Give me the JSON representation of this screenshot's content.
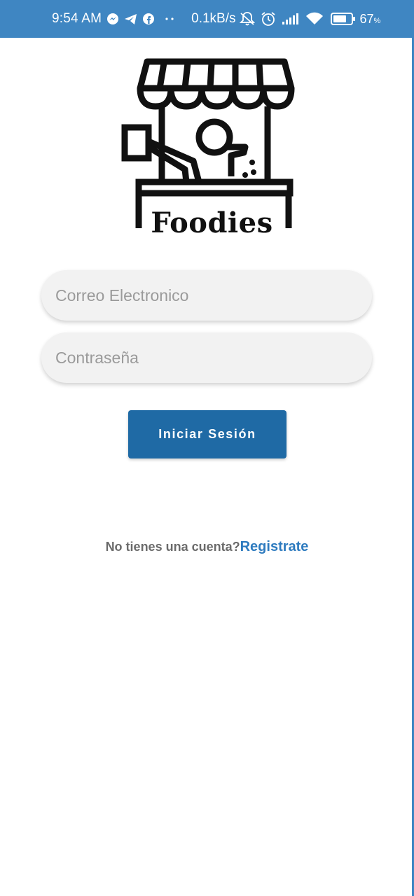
{
  "status_bar": {
    "time": "9:54 AM",
    "network_speed": "0.1kB/s",
    "battery_percent": "67",
    "battery_unit": "%",
    "icons": [
      "messenger-icon",
      "telegram-icon",
      "facebook-icon",
      "more-dots-icon",
      "notifications-muted-icon",
      "alarm-icon",
      "signal-icon",
      "wifi-icon",
      "battery-icon"
    ],
    "background_color": "#3f86c2"
  },
  "logo": {
    "name": "Foodies",
    "icon": "food-stall-icon"
  },
  "login_form": {
    "email_placeholder": "Correo Electronico",
    "email_value": "",
    "password_placeholder": "Contraseña",
    "password_value": "",
    "submit_label": "Iniciar Sesión",
    "submit_color": "#1f6aa5"
  },
  "signup": {
    "prompt": "No tienes una cuenta?",
    "link_label": "Registrate",
    "link_color": "#2e7bbf"
  }
}
